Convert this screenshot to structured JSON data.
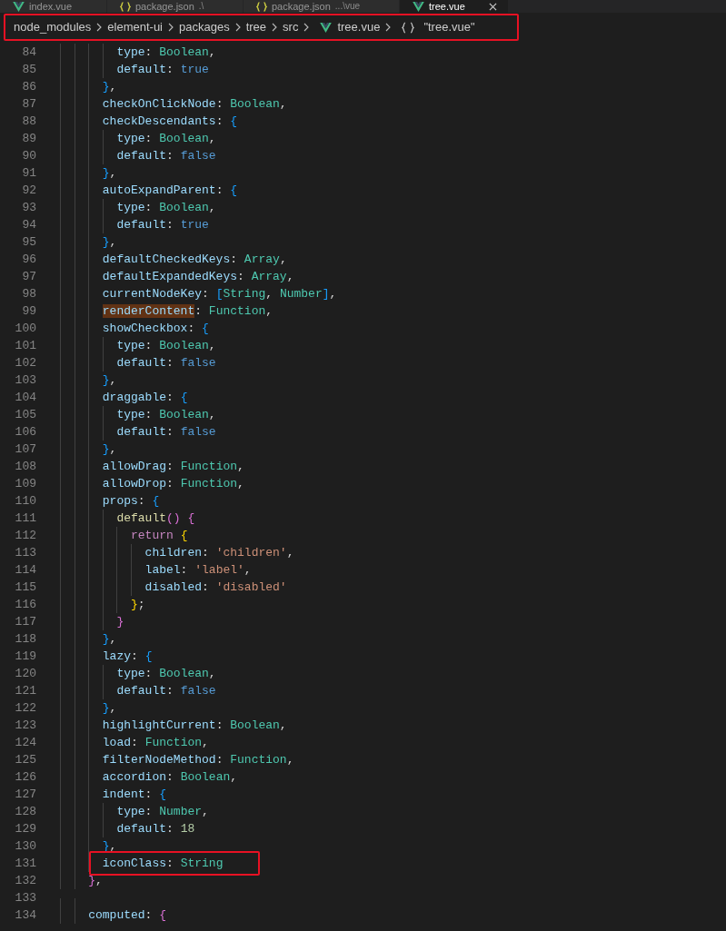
{
  "tabs": [
    {
      "label": "index.vue",
      "kind": "vue",
      "selected": false
    },
    {
      "label": "package.json",
      "kind": "json",
      "detail": ".\\",
      "selected": false
    },
    {
      "label": "package.json",
      "kind": "json",
      "detail": "...\\vue",
      "selected": false
    },
    {
      "label": "tree.vue",
      "kind": "vue",
      "selected": true
    }
  ],
  "breadcrumb": {
    "highlighted": true,
    "items": [
      {
        "label": "node_modules",
        "kind": "folder"
      },
      {
        "label": "element-ui",
        "kind": "folder"
      },
      {
        "label": "packages",
        "kind": "folder"
      },
      {
        "label": "tree",
        "kind": "folder"
      },
      {
        "label": "src",
        "kind": "folder"
      },
      {
        "label": "tree.vue",
        "kind": "vue"
      },
      {
        "label": "\"tree.vue\"",
        "kind": "symbol"
      }
    ]
  },
  "lines": [
    {
      "number": "84",
      "tokens": [
        {
          "kind": "key",
          "text": "type"
        },
        {
          "kind": "plain",
          "text": ":"
        },
        {
          "kind": "type",
          "text": "Boolean"
        },
        {
          "kind": "plain",
          "text": ","
        }
      ]
    },
    {
      "number": "85",
      "tokens": [
        {
          "kind": "key",
          "text": "default"
        },
        {
          "kind": "plain",
          "text": ":"
        },
        {
          "kind": "literal",
          "text": "true"
        }
      ]
    },
    {
      "number": "86",
      "tokens": [
        {
          "kind": "brace1",
          "text": "}"
        },
        {
          "kind": "plain",
          "text": ","
        }
      ]
    },
    {
      "number": "87",
      "tokens": [
        {
          "kind": "key",
          "text": "checkOnClickNode"
        },
        {
          "kind": "plain",
          "text": ":"
        },
        {
          "kind": "type",
          "text": "Boolean"
        },
        {
          "kind": "plain",
          "text": ","
        }
      ]
    },
    {
      "number": "88",
      "tokens": [
        {
          "kind": "key",
          "text": "checkDescendants"
        },
        {
          "kind": "plain",
          "text": ":"
        },
        {
          "kind": "brace1",
          "text": "{"
        }
      ]
    },
    {
      "number": "89",
      "tokens": [
        {
          "kind": "key",
          "text": "type"
        },
        {
          "kind": "plain",
          "text": ":"
        },
        {
          "kind": "type",
          "text": "Boolean"
        },
        {
          "kind": "plain",
          "text": ","
        }
      ]
    },
    {
      "number": "90",
      "tokens": [
        {
          "kind": "key",
          "text": "default"
        },
        {
          "kind": "plain",
          "text": ":"
        },
        {
          "kind": "literal",
          "text": "false"
        }
      ]
    },
    {
      "number": "91",
      "tokens": [
        {
          "kind": "brace1",
          "text": "}"
        },
        {
          "kind": "plain",
          "text": ","
        }
      ]
    },
    {
      "number": "92",
      "tokens": [
        {
          "kind": "key",
          "text": "autoExpandParent"
        },
        {
          "kind": "plain",
          "text": ":"
        },
        {
          "kind": "brace1",
          "text": "{"
        }
      ]
    },
    {
      "number": "93",
      "tokens": [
        {
          "kind": "key",
          "text": "type"
        },
        {
          "kind": "plain",
          "text": ":"
        },
        {
          "kind": "type",
          "text": "Boolean"
        },
        {
          "kind": "plain",
          "text": ","
        }
      ]
    },
    {
      "number": "94",
      "tokens": [
        {
          "kind": "key",
          "text": "default"
        },
        {
          "kind": "plain",
          "text": ":"
        },
        {
          "kind": "literal",
          "text": "true"
        }
      ]
    },
    {
      "number": "95",
      "tokens": [
        {
          "kind": "brace1",
          "text": "}"
        },
        {
          "kind": "plain",
          "text": ","
        }
      ]
    },
    {
      "number": "96",
      "tokens": [
        {
          "kind": "key",
          "text": "defaultCheckedKeys"
        },
        {
          "kind": "plain",
          "text": ":"
        },
        {
          "kind": "type",
          "text": "Array"
        },
        {
          "kind": "plain",
          "text": ","
        }
      ]
    },
    {
      "number": "97",
      "tokens": [
        {
          "kind": "key",
          "text": "defaultExpandedKeys"
        },
        {
          "kind": "plain",
          "text": ":"
        },
        {
          "kind": "type",
          "text": "Array"
        },
        {
          "kind": "plain",
          "text": ","
        }
      ]
    },
    {
      "number": "98",
      "tokens": [
        {
          "kind": "key",
          "text": "currentNodeKey"
        },
        {
          "kind": "plain",
          "text": ":"
        },
        {
          "kind": "brace1",
          "text": "["
        },
        {
          "kind": "type",
          "text": "String"
        },
        {
          "kind": "plain",
          "text": ","
        },
        {
          "kind": "type",
          "text": "Number"
        },
        {
          "kind": "brace1",
          "text": "]"
        },
        {
          "kind": "plain",
          "text": ","
        }
      ]
    },
    {
      "number": "99",
      "tokens": [
        {
          "kind": "match",
          "text": "renderContent"
        },
        {
          "kind": "plain",
          "text": ":"
        },
        {
          "kind": "type",
          "text": "Function"
        },
        {
          "kind": "plain",
          "text": ","
        }
      ]
    },
    {
      "number": "100",
      "tokens": [
        {
          "kind": "key",
          "text": "showCheckbox"
        },
        {
          "kind": "plain",
          "text": ":"
        },
        {
          "kind": "brace1",
          "text": "{"
        }
      ]
    },
    {
      "number": "101",
      "tokens": [
        {
          "kind": "key",
          "text": "type"
        },
        {
          "kind": "plain",
          "text": ":"
        },
        {
          "kind": "type",
          "text": "Boolean"
        },
        {
          "kind": "plain",
          "text": ","
        }
      ]
    },
    {
      "number": "102",
      "tokens": [
        {
          "kind": "key",
          "text": "default"
        },
        {
          "kind": "plain",
          "text": ":"
        },
        {
          "kind": "literal",
          "text": "false"
        }
      ]
    },
    {
      "number": "103",
      "tokens": [
        {
          "kind": "brace1",
          "text": "}"
        },
        {
          "kind": "plain",
          "text": ","
        }
      ]
    },
    {
      "number": "104",
      "tokens": [
        {
          "kind": "key",
          "text": "draggable"
        },
        {
          "kind": "plain",
          "text": ":"
        },
        {
          "kind": "brace1",
          "text": "{"
        }
      ]
    },
    {
      "number": "105",
      "tokens": [
        {
          "kind": "key",
          "text": "type"
        },
        {
          "kind": "plain",
          "text": ":"
        },
        {
          "kind": "type",
          "text": "Boolean"
        },
        {
          "kind": "plain",
          "text": ","
        }
      ]
    },
    {
      "number": "106",
      "tokens": [
        {
          "kind": "key",
          "text": "default"
        },
        {
          "kind": "plain",
          "text": ":"
        },
        {
          "kind": "literal",
          "text": "false"
        }
      ]
    },
    {
      "number": "107",
      "tokens": [
        {
          "kind": "brace1",
          "text": "}"
        },
        {
          "kind": "plain",
          "text": ","
        }
      ]
    },
    {
      "number": "108",
      "tokens": [
        {
          "kind": "key",
          "text": "allowDrag"
        },
        {
          "kind": "plain",
          "text": ":"
        },
        {
          "kind": "type",
          "text": "Function"
        },
        {
          "kind": "plain",
          "text": ","
        }
      ]
    },
    {
      "number": "109",
      "tokens": [
        {
          "kind": "key",
          "text": "allowDrop"
        },
        {
          "kind": "plain",
          "text": ":"
        },
        {
          "kind": "type",
          "text": "Function"
        },
        {
          "kind": "plain",
          "text": ","
        }
      ]
    },
    {
      "number": "110",
      "tokens": [
        {
          "kind": "key",
          "text": "props"
        },
        {
          "kind": "plain",
          "text": ":"
        },
        {
          "kind": "brace1",
          "text": "{"
        }
      ]
    },
    {
      "number": "111",
      "tokens": [
        {
          "kind": "fn",
          "text": "default"
        },
        {
          "kind": "brace2",
          "text": "()"
        },
        {
          "kind": "brace2",
          "text": "{"
        }
      ]
    },
    {
      "number": "112",
      "tokens": [
        {
          "kind": "keyword",
          "text": "return"
        },
        {
          "kind": "brace3",
          "text": "{"
        }
      ]
    },
    {
      "number": "113",
      "tokens": [
        {
          "kind": "key",
          "text": "children"
        },
        {
          "kind": "plain",
          "text": ":"
        },
        {
          "kind": "string",
          "text": "'children'"
        },
        {
          "kind": "plain",
          "text": ","
        }
      ]
    },
    {
      "number": "114",
      "tokens": [
        {
          "kind": "key",
          "text": "label"
        },
        {
          "kind": "plain",
          "text": ":"
        },
        {
          "kind": "string",
          "text": "'label'"
        },
        {
          "kind": "plain",
          "text": ","
        }
      ]
    },
    {
      "number": "115",
      "tokens": [
        {
          "kind": "key",
          "text": "disabled"
        },
        {
          "kind": "plain",
          "text": ":"
        },
        {
          "kind": "string",
          "text": "'disabled'"
        }
      ]
    },
    {
      "number": "116",
      "tokens": [
        {
          "kind": "brace3",
          "text": "}"
        },
        {
          "kind": "plain",
          "text": ";"
        }
      ]
    },
    {
      "number": "117",
      "tokens": [
        {
          "kind": "brace2",
          "text": "}"
        }
      ]
    },
    {
      "number": "118",
      "tokens": [
        {
          "kind": "brace1",
          "text": "}"
        },
        {
          "kind": "plain",
          "text": ","
        }
      ]
    },
    {
      "number": "119",
      "tokens": [
        {
          "kind": "key",
          "text": "lazy"
        },
        {
          "kind": "plain",
          "text": ":"
        },
        {
          "kind": "brace1",
          "text": "{"
        }
      ]
    },
    {
      "number": "120",
      "tokens": [
        {
          "kind": "key",
          "text": "type"
        },
        {
          "kind": "plain",
          "text": ":"
        },
        {
          "kind": "type",
          "text": "Boolean"
        },
        {
          "kind": "plain",
          "text": ","
        }
      ]
    },
    {
      "number": "121",
      "tokens": [
        {
          "kind": "key",
          "text": "default"
        },
        {
          "kind": "plain",
          "text": ":"
        },
        {
          "kind": "literal",
          "text": "false"
        }
      ]
    },
    {
      "number": "122",
      "tokens": [
        {
          "kind": "brace1",
          "text": "}"
        },
        {
          "kind": "plain",
          "text": ","
        }
      ]
    },
    {
      "number": "123",
      "tokens": [
        {
          "kind": "key",
          "text": "highlightCurrent"
        },
        {
          "kind": "plain",
          "text": ":"
        },
        {
          "kind": "type",
          "text": "Boolean"
        },
        {
          "kind": "plain",
          "text": ","
        }
      ]
    },
    {
      "number": "124",
      "tokens": [
        {
          "kind": "key",
          "text": "load"
        },
        {
          "kind": "plain",
          "text": ":"
        },
        {
          "kind": "type",
          "text": "Function"
        },
        {
          "kind": "plain",
          "text": ","
        }
      ]
    },
    {
      "number": "125",
      "tokens": [
        {
          "kind": "key",
          "text": "filterNodeMethod"
        },
        {
          "kind": "plain",
          "text": ":"
        },
        {
          "kind": "type",
          "text": "Function"
        },
        {
          "kind": "plain",
          "text": ","
        }
      ]
    },
    {
      "number": "126",
      "tokens": [
        {
          "kind": "key",
          "text": "accordion"
        },
        {
          "kind": "plain",
          "text": ":"
        },
        {
          "kind": "type",
          "text": "Boolean"
        },
        {
          "kind": "plain",
          "text": ","
        }
      ]
    },
    {
      "number": "127",
      "tokens": [
        {
          "kind": "key",
          "text": "indent"
        },
        {
          "kind": "plain",
          "text": ":"
        },
        {
          "kind": "brace1",
          "text": "{"
        }
      ]
    },
    {
      "number": "128",
      "tokens": [
        {
          "kind": "key",
          "text": "type"
        },
        {
          "kind": "plain",
          "text": ":"
        },
        {
          "kind": "type",
          "text": "Number"
        },
        {
          "kind": "plain",
          "text": ","
        }
      ]
    },
    {
      "number": "129",
      "tokens": [
        {
          "kind": "key",
          "text": "default"
        },
        {
          "kind": "plain",
          "text": ":"
        },
        {
          "kind": "number",
          "text": "18"
        }
      ]
    },
    {
      "number": "130",
      "tokens": [
        {
          "kind": "brace1",
          "text": "}"
        },
        {
          "kind": "plain",
          "text": ","
        }
      ]
    },
    {
      "number": "131",
      "highlighted": true,
      "tokens": [
        {
          "kind": "key",
          "text": "iconClass"
        },
        {
          "kind": "plain",
          "text": ":"
        },
        {
          "kind": "type",
          "text": "String"
        }
      ]
    },
    {
      "number": "132",
      "tokens": [
        {
          "kind": "brace2",
          "text": "}"
        },
        {
          "kind": "plain",
          "text": ","
        }
      ]
    },
    {
      "number": "133"
    },
    {
      "number": "134",
      "tokens": [
        {
          "kind": "key",
          "text": "computed"
        },
        {
          "kind": "plain",
          "text": ":"
        },
        {
          "kind": "brace2",
          "text": "{"
        }
      ]
    }
  ]
}
